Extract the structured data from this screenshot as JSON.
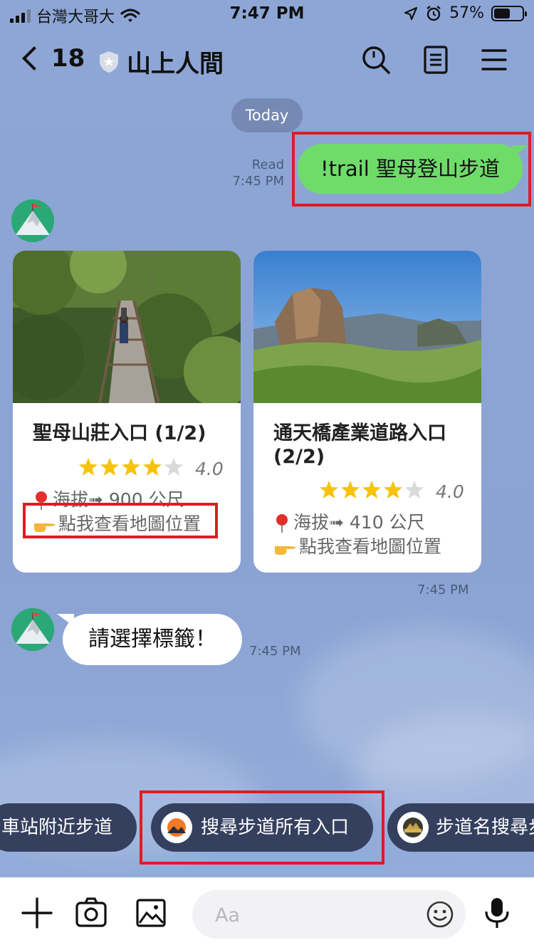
{
  "status_bar": {
    "carrier": "台灣大哥大",
    "time": "7:47 PM",
    "battery": "57%",
    "battery_level": 0.57
  },
  "header": {
    "unread_count": "18",
    "title": "山上人間"
  },
  "date_separator": "Today",
  "outgoing_message": {
    "read_label": "Read",
    "time": "7:45 PM",
    "text": "!trail 聖母登山步道"
  },
  "cards": [
    {
      "title": "聖母山莊入口 (1/2)",
      "rating": "4.0",
      "rating_value": 4,
      "elevation": "海拔➟ 900 公尺",
      "map_link": "點我查看地圖位置"
    },
    {
      "title": "通天橋產業道路入口 (2/2)",
      "rating": "4.0",
      "rating_value": 4,
      "elevation": "海拔➟ 410 公尺",
      "map_link": "點我查看地圖位置"
    }
  ],
  "cards_time": "7:45 PM",
  "incoming_message": {
    "text": "請選擇標籤！",
    "time": "7:45 PM"
  },
  "quick_replies": [
    {
      "label": "車站附近步道"
    },
    {
      "label": "搜尋步道所有入口"
    },
    {
      "label": "步道名搜尋步"
    }
  ],
  "input": {
    "placeholder": "Aa"
  },
  "colors": {
    "background": "#8ea6d6",
    "outgoing_bubble": "#6fdc6a",
    "highlight_box": "#e01b24",
    "quick_reply": "#35405f"
  }
}
